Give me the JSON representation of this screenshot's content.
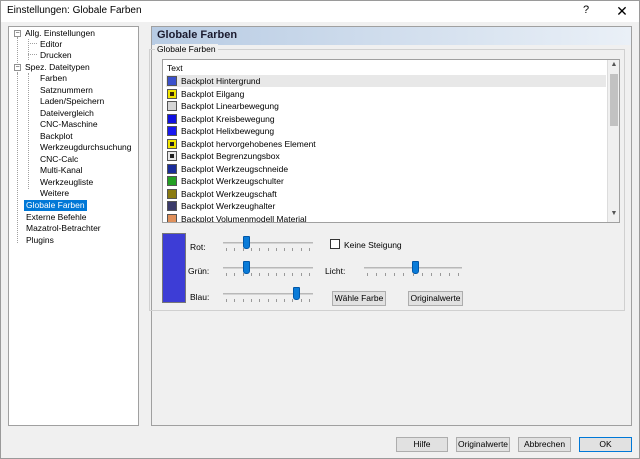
{
  "window": {
    "title": "Einstellungen: Globale Farben",
    "help_glyph": "?",
    "close_glyph": "✕"
  },
  "tree": {
    "items": [
      {
        "label": "Allg. Einstellungen",
        "toggle": "−"
      },
      {
        "label": "Editor"
      },
      {
        "label": "Drucken"
      },
      {
        "label": "Spez. Dateitypen",
        "toggle": "−"
      },
      {
        "label": "Farben"
      },
      {
        "label": "Satznummern"
      },
      {
        "label": "Laden/Speichern"
      },
      {
        "label": "Dateivergleich"
      },
      {
        "label": "CNC-Maschine"
      },
      {
        "label": "Backplot"
      },
      {
        "label": "Werkzeugdurchsuchung"
      },
      {
        "label": "CNC-Calc"
      },
      {
        "label": "Multi-Kanal"
      },
      {
        "label": "Werkzeugliste"
      },
      {
        "label": "Weitere"
      },
      {
        "label": "Globale Farben",
        "selected": true
      },
      {
        "label": "Externe Befehle"
      },
      {
        "label": "Mazatrol-Betrachter"
      },
      {
        "label": "Plugins"
      }
    ]
  },
  "panel": {
    "header": "Globale Farben",
    "group_title": "Globale Farben"
  },
  "list": {
    "header": "Text",
    "items": [
      {
        "label": "Backplot Hintergrund",
        "color": "#3a50cc",
        "selected": true
      },
      {
        "label": "Backplot Eilgang",
        "color": "#f2e600",
        "dot": "#3a2a00"
      },
      {
        "label": "Backplot Linearbewegung",
        "color": "#d6d6d6"
      },
      {
        "label": "Backplot Kreisbewegung",
        "color": "#1010e0"
      },
      {
        "label": "Backplot Helixbewegung",
        "color": "#1818f0"
      },
      {
        "label": "Backplot hervorgehobenes Element",
        "color": "#f2e600",
        "dot": "#202020"
      },
      {
        "label": "Backplot Begrenzungsbox",
        "color": "#e8e8e8",
        "dot": "#202020"
      },
      {
        "label": "Backplot Werkzeugschneide",
        "color": "#1a2c9a"
      },
      {
        "label": "Backplot Werkzeugschulter",
        "color": "#24a024"
      },
      {
        "label": "Backplot Werkzeugschaft",
        "color": "#8a7a10"
      },
      {
        "label": "Backplot Werkzeughalter",
        "color": "#3a3a6a"
      },
      {
        "label": "Backplot Volumenmodell Material",
        "color": "#e0905a"
      }
    ],
    "scroll_up": "▲",
    "scroll_down": "▼"
  },
  "color_editor": {
    "preview_color": "#3d3dd6",
    "rot_label": "Rot:",
    "gruen_label": "Grün:",
    "blau_label": "Blau:",
    "licht_label": "Licht:",
    "rot_value": 0.24,
    "gruen_value": 0.24,
    "blau_value": 0.84,
    "licht_value": 0.53,
    "keine_steigung_label": "Keine Steigung",
    "keine_steigung_checked": false,
    "waehle_farbe_label": "Wähle Farbe",
    "originalwerte_label": "Originalwerte"
  },
  "footer": {
    "hilfe_label": "Hilfe",
    "originalwerte_label": "Originalwerte",
    "abbrechen_label": "Abbrechen",
    "ok_label": "OK"
  }
}
